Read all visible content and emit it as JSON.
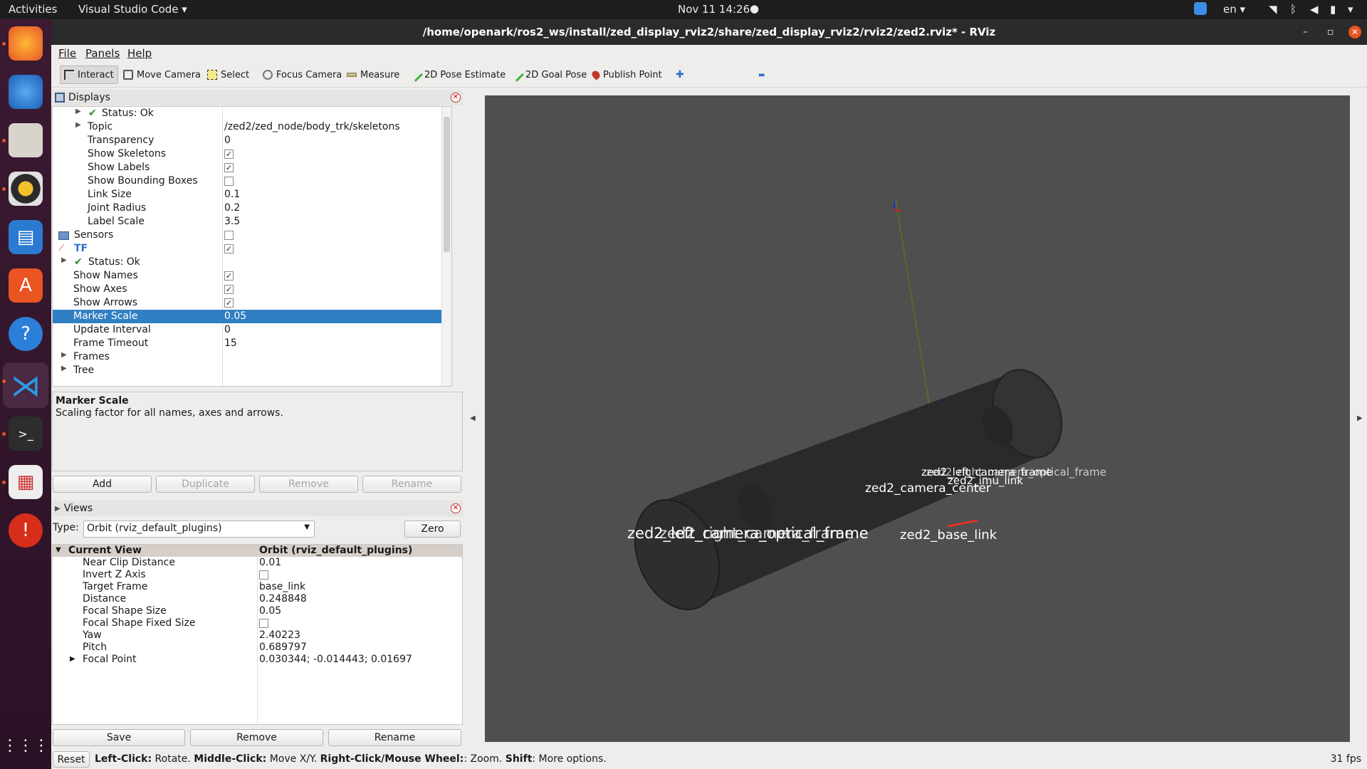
{
  "topbar": {
    "activities": "Activities",
    "app": "Visual Studio Code ▾",
    "clock": "Nov 11  14:26",
    "lang": "en ▾"
  },
  "window": {
    "title": "/home/openark/ros2_ws/install/zed_display_rviz2/share/zed_display_rviz2/rviz2/zed2.rviz* - RViz"
  },
  "menu": {
    "file": "File",
    "panels": "Panels",
    "help": "Help"
  },
  "toolbar": {
    "interact": "Interact",
    "move_camera": "Move Camera",
    "select": "Select",
    "focus_camera": "Focus Camera",
    "measure": "Measure",
    "pose_estimate": "2D Pose Estimate",
    "goal_pose": "2D Goal Pose",
    "publish_point": "Publish Point",
    "plus": "✚",
    "minus": "▬"
  },
  "displays": {
    "title": "Displays",
    "rows": [
      {
        "label": "Status: Ok",
        "value": ""
      },
      {
        "label": "Topic",
        "value": "/zed2/zed_node/body_trk/skeletons"
      },
      {
        "label": "Transparency",
        "value": "0"
      },
      {
        "label": "Show Skeletons",
        "value": "✓"
      },
      {
        "label": "Show Labels",
        "value": "✓"
      },
      {
        "label": "Show Bounding Boxes",
        "value": ""
      },
      {
        "label": "Link Size",
        "value": "0.1"
      },
      {
        "label": "Joint Radius",
        "value": "0.2"
      },
      {
        "label": "Label Scale",
        "value": "3.5"
      },
      {
        "label": "Sensors",
        "value": ""
      },
      {
        "label": "TF",
        "value": "✓"
      },
      {
        "label": "Status: Ok",
        "value": ""
      },
      {
        "label": "Show Names",
        "value": "✓"
      },
      {
        "label": "Show Axes",
        "value": "✓"
      },
      {
        "label": "Show Arrows",
        "value": "✓"
      },
      {
        "label": "Marker Scale",
        "value": "0.05"
      },
      {
        "label": "Update Interval",
        "value": "0"
      },
      {
        "label": "Frame Timeout",
        "value": "15"
      },
      {
        "label": "Frames",
        "value": ""
      },
      {
        "label": "Tree",
        "value": ""
      }
    ],
    "desc_title": "Marker Scale",
    "desc_text": "Scaling factor for all names, axes and arrows.",
    "buttons": {
      "add": "Add",
      "duplicate": "Duplicate",
      "remove": "Remove",
      "rename": "Rename"
    }
  },
  "views": {
    "title": "Views",
    "type_label": "Type:",
    "type_value": "Orbit (rviz_default_plugins)",
    "zero": "Zero",
    "header_label": "Current View",
    "header_value": "Orbit (rviz_default_plugins)",
    "rows": [
      {
        "label": "Near Clip Distance",
        "value": "0.01"
      },
      {
        "label": "Invert Z Axis",
        "value": ""
      },
      {
        "label": "Target Frame",
        "value": "base_link"
      },
      {
        "label": "Distance",
        "value": "0.248848"
      },
      {
        "label": "Focal Shape Size",
        "value": "0.05"
      },
      {
        "label": "Focal Shape Fixed Size",
        "value": ""
      },
      {
        "label": "Yaw",
        "value": "2.40223"
      },
      {
        "label": "Pitch",
        "value": "0.689797"
      },
      {
        "label": "Focal Point",
        "value": "0.030344; -0.014443; 0.01697"
      }
    ],
    "buttons": {
      "save": "Save",
      "remove": "Remove",
      "rename": "Rename"
    }
  },
  "status": {
    "reset": "Reset",
    "left_click": "Left-Click:",
    "rotate": " Rotate. ",
    "middle_click": "Middle-Click:",
    "move": " Move X/Y. ",
    "right_click": "Right-Click/Mouse Wheel:",
    "zoom": ": Zoom. ",
    "shift": "Shift",
    "more": ": More options.",
    "fps": "31 fps"
  },
  "scene": {
    "labels": [
      "zed2_left_camera_frame",
      "zed2_imu_link",
      "zed2_camera_center",
      "zed2_left_camera_optical_frame",
      "zed2_base_link",
      "zed2_right_camera_frame",
      "zed2_right_camera_optical_frame"
    ]
  }
}
